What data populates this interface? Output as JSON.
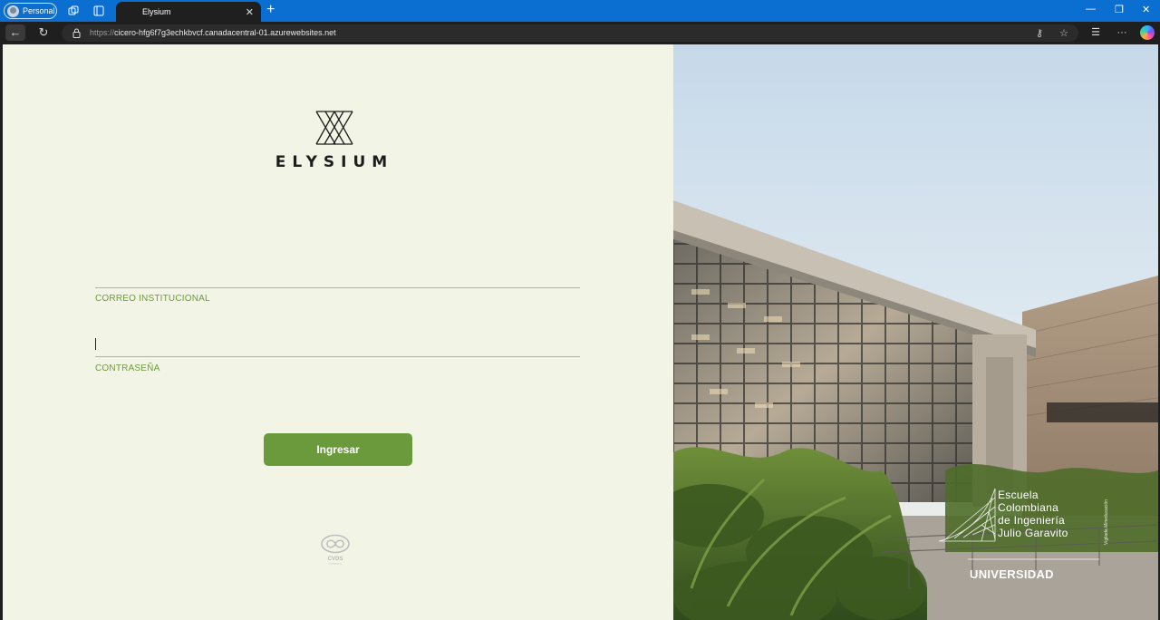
{
  "browser": {
    "profile_label": "Personal",
    "tab_title": "Elysium",
    "url_protocol": "https://",
    "url_host": "cicero-hfg6f7g3echkbvcf.canadacentral-01.azurewebsites.net"
  },
  "login": {
    "logo_text": "ELYSIUM",
    "email_label": "CORREO INSTITUCIONAL",
    "email_value": "",
    "password_label": "CONTRASEÑA",
    "password_value": "",
    "submit_label": "Ingresar"
  },
  "footer": {
    "cvds_label": "CVDS",
    "cvds_sub": "COMPANY"
  },
  "photo": {
    "university_lines": [
      "Escuela",
      "Colombiana",
      "de Ingeniería",
      "Julio Garavito"
    ],
    "university_tag": "UNIVERSIDAD",
    "vertical_note": "Vigilada Mineducación"
  },
  "colors": {
    "page_bg": "#f2f5e6",
    "accent_green": "#6b9a3c",
    "label_green": "#6e9a3b",
    "browser_blue": "#0a6fd0"
  }
}
